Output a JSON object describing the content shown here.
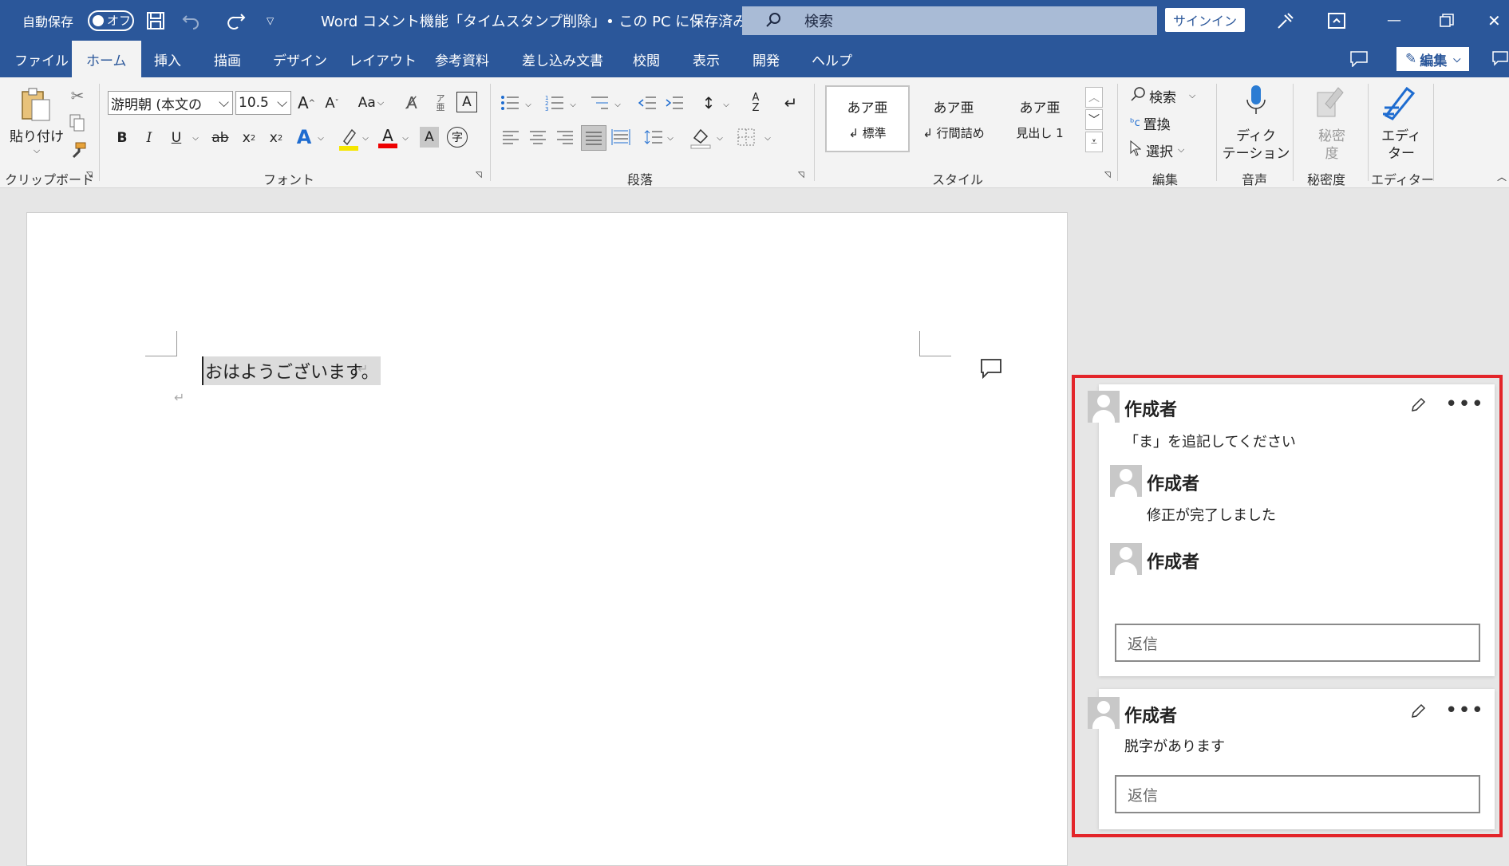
{
  "titlebar": {
    "autosave_label": "自動保存",
    "autosave_state": "オフ",
    "doc_title": "Word コメント機能「タイムスタンプ削除」• この PC に保存済み",
    "search_placeholder": "検索",
    "signin_label": "サインイン"
  },
  "tabs": [
    "ファイル",
    "ホーム",
    "挿入",
    "描画",
    "デザイン",
    "レイアウト",
    "参考資料",
    "差し込み文書",
    "校閲",
    "表示",
    "開発",
    "ヘルプ"
  ],
  "active_tab": "ホーム",
  "edit_mode_label": "編集",
  "ribbon": {
    "paste_label": "貼り付け",
    "clipboard_group": "クリップボード",
    "font_name": "游明朝 (本文の",
    "font_size": "10.5",
    "font_group": "フォント",
    "case_label": "Aa",
    "paragraph_group": "段落",
    "styles": [
      {
        "sample": "あア亜",
        "name": "↲ 標準"
      },
      {
        "sample": "あア亜",
        "name": "↲ 行間詰め"
      },
      {
        "sample": "あア亜",
        "name": "見出し 1"
      }
    ],
    "styles_group": "スタイル",
    "find_label": "検索",
    "replace_label": "置換",
    "select_label": "選択",
    "editing_group": "編集",
    "dictate_label_1": "ディク",
    "dictate_label_2": "テーション",
    "voice_group": "音声",
    "sensitivity_label_1": "秘密",
    "sensitivity_label_2": "度",
    "sensitivity_group": "秘密度",
    "editor_label_1": "エディ",
    "editor_label_2": "ター",
    "editor_group": "エディター"
  },
  "document": {
    "text": "おはようございます。"
  },
  "comments": [
    {
      "author": "作成者",
      "text": "「ま」を追記してください",
      "replies": [
        {
          "author": "作成者",
          "text": "修正が完了しました"
        },
        {
          "author": "作成者",
          "text": ""
        }
      ],
      "reply_placeholder": "返信"
    },
    {
      "author": "作成者",
      "text": "脱字があります",
      "replies": [],
      "reply_placeholder": "返信"
    }
  ],
  "colors": {
    "brand": "#2b579a",
    "highlight_border": "#e3252a"
  }
}
